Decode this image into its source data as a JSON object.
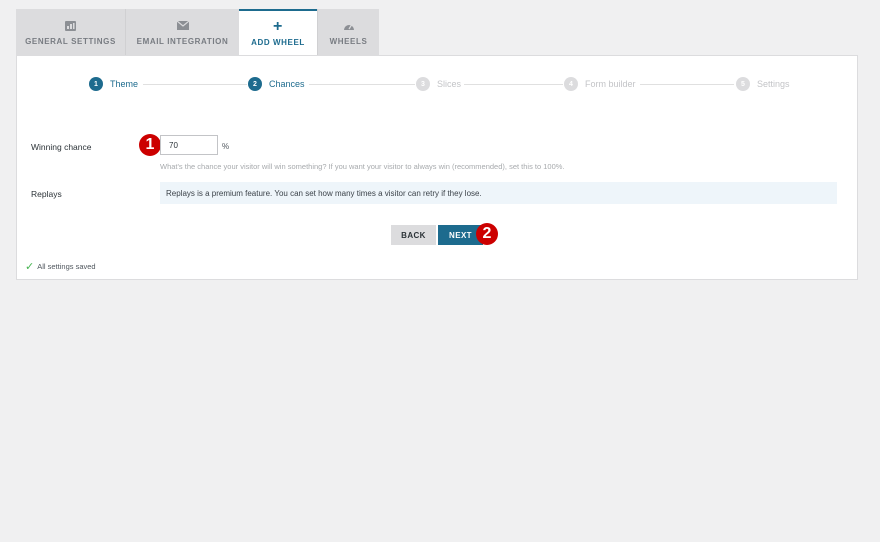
{
  "tabs": [
    {
      "label": "GENERAL SETTINGS",
      "icon": "dashboard-icon"
    },
    {
      "label": "EMAIL INTEGRATION",
      "icon": "envelope-icon"
    },
    {
      "label": "ADD WHEEL",
      "icon": "plus-icon",
      "active": true
    },
    {
      "label": "WHEELS",
      "icon": "gauge-icon"
    }
  ],
  "steps": [
    {
      "num": "1",
      "label": "Theme",
      "state": "active"
    },
    {
      "num": "2",
      "label": "Chances",
      "state": "active"
    },
    {
      "num": "3",
      "label": "Slices",
      "state": "inactive"
    },
    {
      "num": "4",
      "label": "Form builder",
      "state": "inactive"
    },
    {
      "num": "5",
      "label": "Settings",
      "state": "inactive"
    }
  ],
  "form": {
    "winning_label": "Winning chance",
    "winning_value": "70",
    "percent": "%",
    "winning_hint": "What's the chance your visitor will win something? If you want your visitor to always win (recommended), set this to 100%.",
    "replays_label": "Replays",
    "replays_notice": "Replays is a premium feature. You can set how many times a visitor can retry if they lose."
  },
  "buttons": {
    "back": "BACK",
    "next": "NEXT"
  },
  "markers": {
    "one": "1",
    "two": "2"
  },
  "status": {
    "saved": "All settings saved"
  },
  "colors": {
    "accent": "#1d6b8e",
    "marker": "#cc0000",
    "success": "#46b450"
  }
}
